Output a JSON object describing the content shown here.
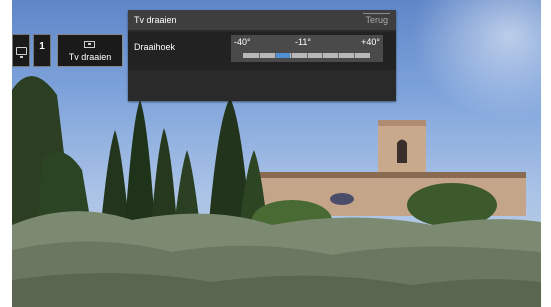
{
  "osd": {
    "source_icon": "tv-monitor-icon",
    "channel_number": "1",
    "mode_icon": "tv-rotate-icon",
    "mode_label": "Tv draaien"
  },
  "menu": {
    "title": "Tv draaien",
    "back_label": "Terug",
    "row_label": "Draaihoek",
    "slider": {
      "min_label": "-40°",
      "value_label": "-11°",
      "max_label": "+40°",
      "min": -40,
      "max": 40,
      "value": -11,
      "accent_color": "#4f8fd4"
    }
  }
}
